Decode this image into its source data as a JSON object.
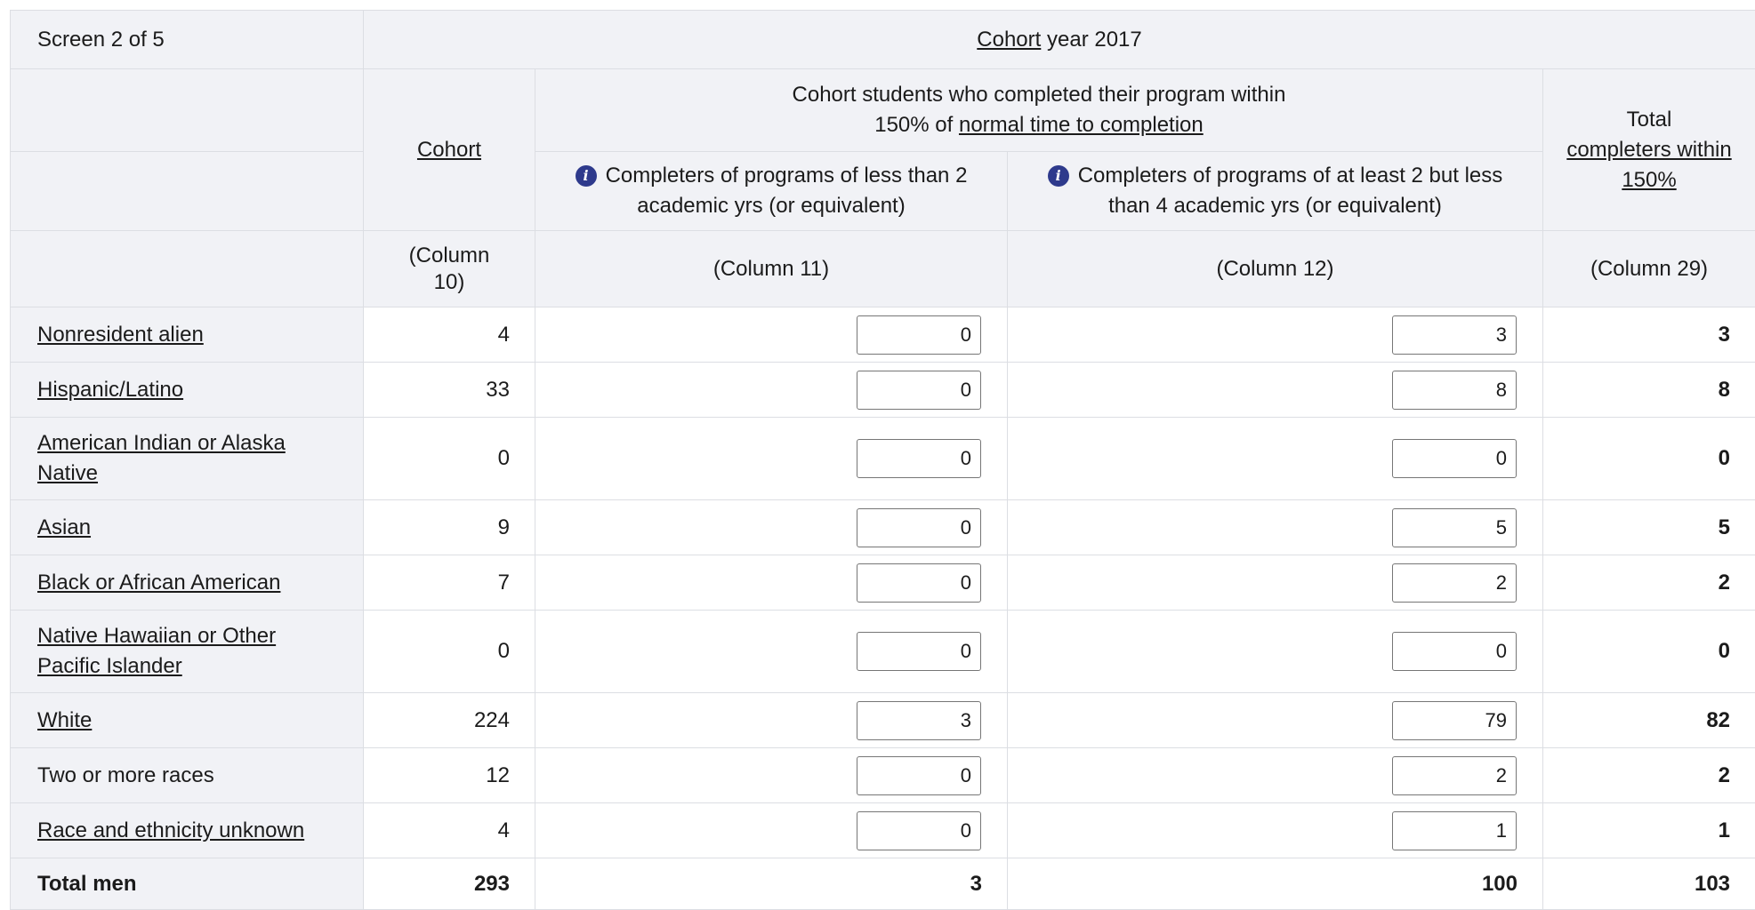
{
  "screen_label": "Screen 2 of 5",
  "cohort_year": {
    "link": "Cohort",
    "rest": " year 2017"
  },
  "headers": {
    "cohort": "Cohort",
    "group_line1": "Cohort students who completed their program within",
    "group_line2_prefix": "150% of ",
    "group_line2_link": "normal time to completion",
    "col11_title": "Completers of programs of less than 2 academic yrs (or equivalent)",
    "col12_title": "Completers of programs of at least 2 but less than 4 academic yrs (or equivalent)",
    "total_line1": "Total",
    "total_link": "completers within 150%",
    "col10": "(Column 10)",
    "col11": "(Column 11)",
    "col12": "(Column 12)",
    "col29": "(Column 29)"
  },
  "rows": [
    {
      "label": "Nonresident alien",
      "linked": true,
      "cohort": "4",
      "c11": "0",
      "c12": "3",
      "total": "3"
    },
    {
      "label": "Hispanic/Latino",
      "linked": true,
      "cohort": "33",
      "c11": "0",
      "c12": "8",
      "total": "8"
    },
    {
      "label": "American Indian or Alaska Native",
      "linked": true,
      "cohort": "0",
      "c11": "0",
      "c12": "0",
      "total": "0"
    },
    {
      "label": "Asian",
      "linked": true,
      "cohort": "9",
      "c11": "0",
      "c12": "5",
      "total": "5"
    },
    {
      "label": "Black or African American",
      "linked": true,
      "cohort": "7",
      "c11": "0",
      "c12": "2",
      "total": "2"
    },
    {
      "label": "Native Hawaiian or Other Pacific Islander",
      "linked": true,
      "cohort": "0",
      "c11": "0",
      "c12": "0",
      "total": "0"
    },
    {
      "label": "White",
      "linked": true,
      "cohort": "224",
      "c11": "3",
      "c12": "79",
      "total": "82"
    },
    {
      "label": "Two or more races",
      "linked": false,
      "cohort": "12",
      "c11": "0",
      "c12": "2",
      "total": "2"
    },
    {
      "label": "Race and ethnicity unknown",
      "linked": true,
      "cohort": "4",
      "c11": "0",
      "c12": "1",
      "total": "1"
    }
  ],
  "total_row": {
    "label": "Total men",
    "cohort": "293",
    "c11": "3",
    "c12": "100",
    "total": "103"
  },
  "icons": {
    "info": "info-icon"
  },
  "colors": {
    "header_bg": "#f1f2f6",
    "border": "#dcdee3",
    "info_icon": "#2e3a8c"
  }
}
